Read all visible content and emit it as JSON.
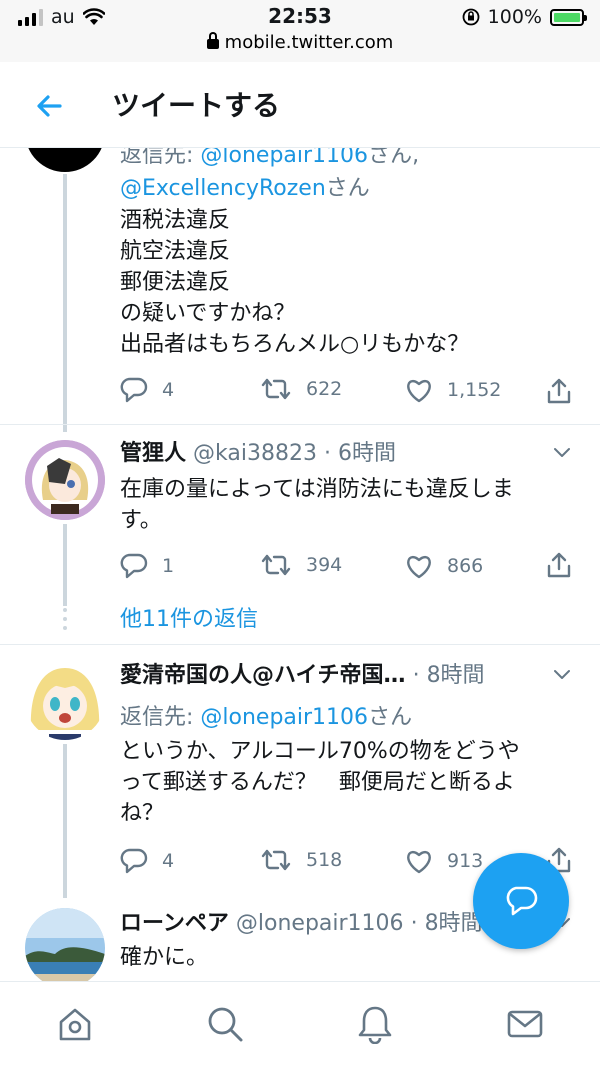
{
  "status_bar": {
    "carrier": "au",
    "time": "22:53",
    "url": "mobile.twitter.com",
    "battery": "100%"
  },
  "header": {
    "title": "ツイートする"
  },
  "tweets": [
    {
      "reply_to_prefix": "返信先: ",
      "reply_to_handle_1": "@lonepair1106",
      "reply_to_sep": "さん, ",
      "reply_to_handle_2": "@ExcellencyRozen",
      "reply_to_suffix": "さん",
      "text": "酒税法違反\n航空法違反\n郵便法違反\nの疑いですかね？\n出品者はもちろんメル○リもかな？",
      "replies": "4",
      "retweets": "622",
      "likes": "1,152"
    },
    {
      "name": "管狸人",
      "handle": "@kai38823",
      "sep": "·",
      "time": "6時間",
      "text": "在庫の量によっては消防法にも違反しま\nす。",
      "replies": "1",
      "retweets": "394",
      "likes": "866"
    },
    {
      "more_replies": "他11件の返信"
    },
    {
      "name": "愛清帝国の人@ハイチ帝国…",
      "sep": "·",
      "time": "8時間",
      "reply_to_prefix": "返信先: ",
      "reply_to_handle_1": "@lonepair1106",
      "reply_to_suffix": "さん",
      "text": "というか、アルコール70%の物をどうや\nって郵送するんだ？　郵便局だと断るよ\nね？",
      "replies": "4",
      "retweets": "518",
      "likes": "913"
    },
    {
      "name": "ローンペア",
      "handle": "@lonepair1106",
      "sep": "·",
      "time": "8時間",
      "text": "確かに。"
    }
  ],
  "colors": {
    "accent": "#1da1f2",
    "link": "#1b95e0",
    "meta": "#657786",
    "thread_line": "#ccd6dd"
  },
  "icons": {
    "back": "arrow-left-icon",
    "reply": "reply-bubble-icon",
    "retweet": "retweet-icon",
    "like": "heart-icon",
    "share": "share-icon",
    "caret": "chevron-down-icon",
    "compose": "compose-bubble-icon",
    "home": "home-icon",
    "search": "search-icon",
    "notifications": "bell-icon",
    "messages": "mail-icon"
  }
}
